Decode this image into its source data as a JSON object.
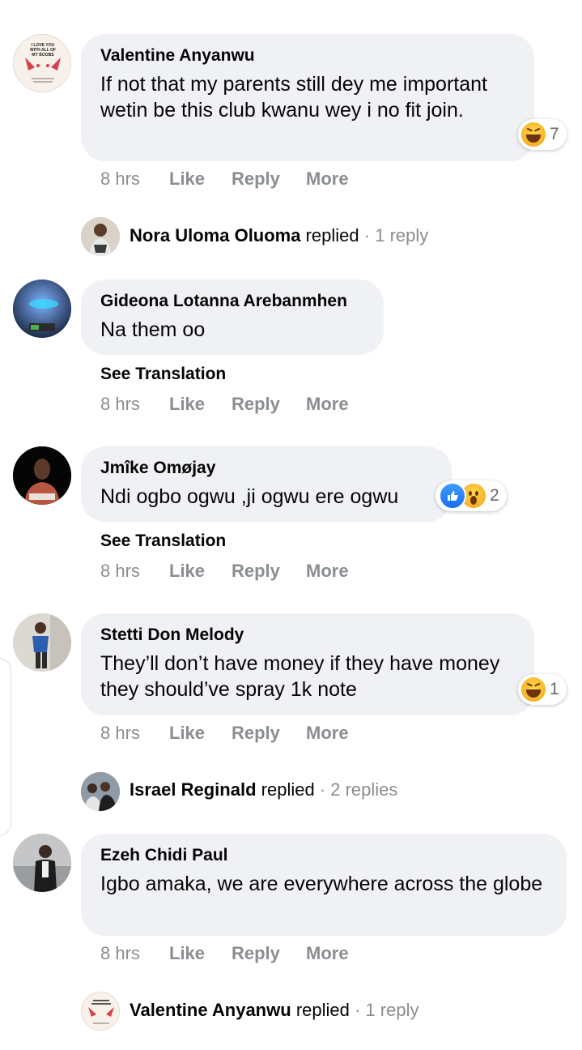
{
  "comments": [
    {
      "author": "Valentine Anyanwu",
      "text": "If not that my parents still dey me important wetin be this club kwanu wey i no fit join.",
      "time": "8 hrs",
      "like": "Like",
      "reply": "Reply",
      "more": "More",
      "reactions": {
        "types": [
          "haha"
        ],
        "count": "7"
      },
      "avatar_text": "I LOVE YOU WITH ALL OF MY BOOBS"
    },
    {
      "author": "Gideona Lotanna Arebanmhen",
      "text": "Na them oo",
      "see_translation": "See Translation",
      "time": "8 hrs",
      "like": "Like",
      "reply": "Reply",
      "more": "More"
    },
    {
      "author": "Jmîke Omøjay",
      "text": "Ndi ogbo ogwu ,ji ogwu ere ogwu",
      "see_translation": "See Translation",
      "time": "8 hrs",
      "like": "Like",
      "reply": "Reply",
      "more": "More",
      "reactions": {
        "types": [
          "like",
          "wow"
        ],
        "count": "2"
      }
    },
    {
      "author": "Stetti Don Melody",
      "text": "They’ll don’t have money if they have money they should’ve spray 1k note",
      "time": "8 hrs",
      "like": "Like",
      "reply": "Reply",
      "more": "More",
      "reactions": {
        "types": [
          "haha"
        ],
        "count": "1"
      }
    },
    {
      "author": "Ezeh Chidi Paul",
      "text": "Igbo amaka, we are everywhere across the globe",
      "time": "8 hrs",
      "like": "Like",
      "reply": "Reply",
      "more": "More"
    }
  ],
  "reply_summaries": [
    {
      "name": "Nora Uloma Oluoma",
      "verb": "replied",
      "count": "· 1 reply"
    },
    {
      "name": "Israel Reginald",
      "verb": "replied",
      "count": "· 2 replies"
    },
    {
      "name": "Valentine Anyanwu",
      "verb": "replied",
      "count": "· 1 reply"
    }
  ],
  "colors": {
    "bubble": "#eff1f4",
    "muted": "#8a8d91",
    "like_blue": "#1877f2",
    "haha_yellow": "#f7b125"
  },
  "icons": [
    "haha-reaction-icon",
    "like-reaction-icon",
    "wow-reaction-icon"
  ]
}
